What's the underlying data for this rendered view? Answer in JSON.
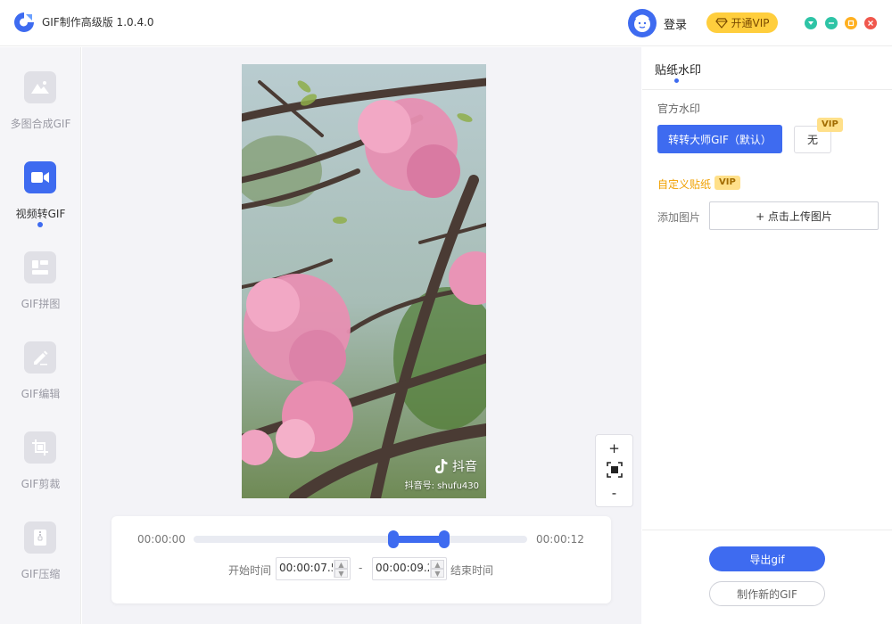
{
  "app": {
    "title": "GIF制作高级版 1.0.4.0"
  },
  "header": {
    "login": "登录",
    "vip": "开通VIP"
  },
  "colors": {
    "accent": "#3e6bf0",
    "vip": "#ffce3d",
    "win_min": "#2ec4a6",
    "win_max": "#ffb020",
    "win_close": "#f0574d",
    "win_menu": "#2ec4a6"
  },
  "sidebar": {
    "items": [
      {
        "label": "多图合成GIF",
        "icon": "mountain-image-icon"
      },
      {
        "label": "视频转GIF",
        "icon": "video-camera-icon",
        "active": true
      },
      {
        "label": "GIF拼图",
        "icon": "collage-icon"
      },
      {
        "label": "GIF编辑",
        "icon": "pencil-icon"
      },
      {
        "label": "GIF剪裁",
        "icon": "crop-icon"
      },
      {
        "label": "GIF压缩",
        "icon": "zip-icon"
      }
    ]
  },
  "preview": {
    "brand": "抖音",
    "account": "抖音号: shufu430"
  },
  "zoom": {
    "in": "+",
    "out": "-"
  },
  "timeline": {
    "start": "00:00:00",
    "end": "00:00:12",
    "selection_start_fraction": 0.6,
    "selection_end_fraction": 0.75,
    "start_label": "开始时间",
    "start_value": "00:00:07.5",
    "separator": "-",
    "end_value": "00:00:09.2",
    "end_label": "结束时间"
  },
  "panel": {
    "tab": "贴纸水印",
    "official_title": "官方水印",
    "official_default": "转转大师GIF（默认）",
    "none": "无",
    "vip_badge": "VIP",
    "custom_title": "自定义贴纸",
    "add_image_label": "添加图片",
    "upload": "+ 点击上传图片",
    "export": "导出gif",
    "new_gif": "制作新的GIF"
  }
}
